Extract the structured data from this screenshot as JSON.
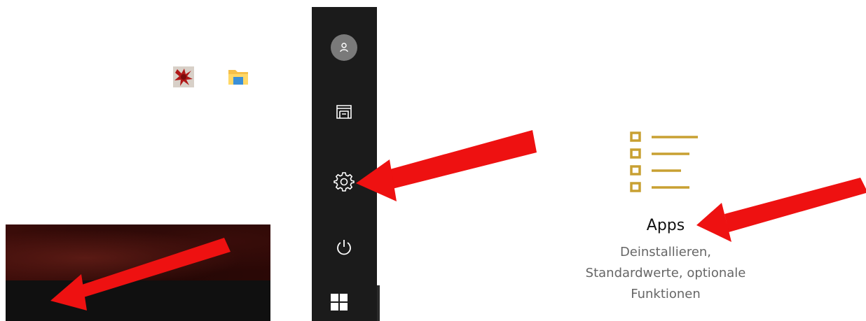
{
  "taskbar": {
    "icons": [
      "windows-start-icon",
      "cortana-circle-icon",
      "task-view-icon",
      "app-red-splat-icon",
      "file-explorer-icon"
    ]
  },
  "start_menu": {
    "rail_icons": [
      "user-avatar-icon",
      "documents-folder-icon",
      "settings-gear-icon",
      "power-icon",
      "windows-start-icon"
    ]
  },
  "settings_tile": {
    "title": "Apps",
    "description_lines": [
      "Deinstallieren,",
      "Standardwerte, optionale",
      "Funktionen"
    ],
    "icon": "apps-list-icon",
    "icon_color": "#c8a032"
  },
  "annotations": {
    "arrow_color": "#ee1111"
  }
}
